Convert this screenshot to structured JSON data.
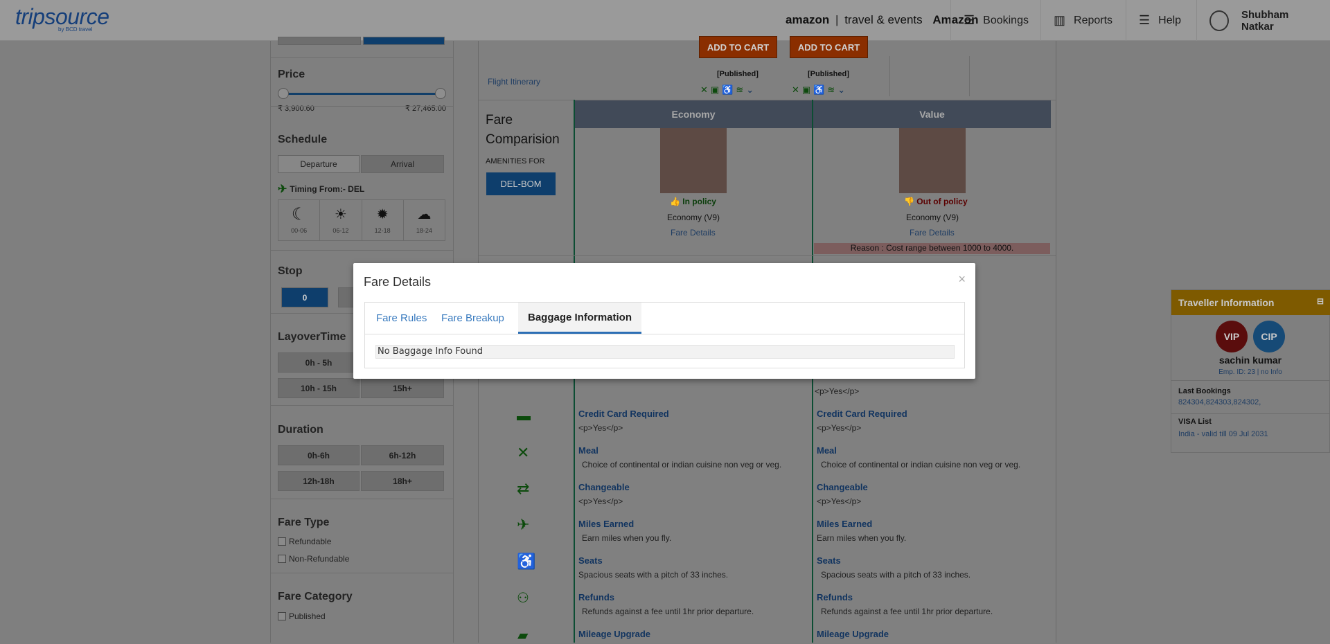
{
  "header": {
    "logo": "tripsource",
    "logo_sub": "by BCD travel",
    "client_brand": "amazon",
    "client_sub": "travel & events",
    "client_name": "Amazon",
    "nav": [
      {
        "label": "Bookings",
        "icon": "bookings-icon"
      },
      {
        "label": "Reports",
        "icon": "bar-chart-icon"
      },
      {
        "label": "Help",
        "icon": "menu-icon"
      }
    ],
    "user_name": "Shubham Natkar"
  },
  "filters": {
    "price": {
      "title": "Price",
      "min": "₹ 3,900.60",
      "max": "₹ 27,465.00"
    },
    "schedule": {
      "title": "Schedule",
      "tabs": [
        "Departure",
        "Arrival"
      ],
      "timing_label": "Timing From:- DEL",
      "slots": [
        {
          "label": "00-06",
          "icon": "moon-icon"
        },
        {
          "label": "06-12",
          "icon": "sunrise-icon"
        },
        {
          "label": "12-18",
          "icon": "sun-icon"
        },
        {
          "label": "18-24",
          "icon": "sunset-icon"
        }
      ]
    },
    "stop": {
      "title": "Stop",
      "options": [
        "0"
      ]
    },
    "layover": {
      "title": "LayoverTime",
      "options": [
        "0h - 5h",
        "10h - 15h",
        "15h+"
      ]
    },
    "duration": {
      "title": "Duration",
      "options": [
        "0h-6h",
        "6h-12h",
        "12h-18h",
        "18h+"
      ]
    },
    "fare_type": {
      "title": "Fare Type",
      "options": [
        "Refundable",
        "Non-Refundable"
      ]
    },
    "fare_category": {
      "title": "Fare Category",
      "options": [
        "Published"
      ]
    }
  },
  "results": {
    "flight_itinerary": "Flight Itinerary",
    "add_to_cart": "ADD TO CART",
    "published": "[Published]",
    "fare_comparison_title": "Fare Comparision",
    "amenities_for": "AMENITIES FOR",
    "route": "DEL-BOM",
    "columns": [
      {
        "name": "Economy",
        "policy": "In policy",
        "fare_class": "Economy (V9)",
        "fare_details": "Fare Details"
      },
      {
        "name": "Value",
        "policy": "Out of policy",
        "fare_class": "Economy (V9)",
        "fare_details": "Fare Details",
        "reason": "Reason : Cost range between 1000 to 4000."
      }
    ],
    "amenities": [
      {
        "title": "",
        "left": "",
        "right": "<p>Yes</p>"
      },
      {
        "title": "Credit Card Required",
        "left": "<p>Yes</p>",
        "right": "<p>Yes</p>"
      },
      {
        "title": "Meal",
        "left": "Choice of continental or indian cuisine non veg or veg.",
        "right": "Choice of continental or indian cuisine non veg or veg."
      },
      {
        "title": "Changeable",
        "left": "<p>Yes</p>",
        "right": "<p>Yes</p>"
      },
      {
        "title": "Miles Earned",
        "left": "Earn miles when you fly.",
        "right": "Earn miles when you fly."
      },
      {
        "title": "Seats",
        "left": "Spacious seats with a pitch of 33 inches.",
        "right": "Spacious seats with a pitch of 33 inches."
      },
      {
        "title": "Refunds",
        "left": "Refunds against a fee until 1hr prior departure.",
        "right": "Refunds against a fee until 1hr prior departure."
      },
      {
        "title": "Mileage Upgrade",
        "left": "",
        "right": ""
      }
    ]
  },
  "traveller": {
    "title": "Traveller Information",
    "badges": [
      "VIP",
      "CIP"
    ],
    "name": "sachin kumar",
    "emp": "Emp. ID: 23 | no Info",
    "last_bookings_label": "Last Bookings",
    "last_bookings": "824304,824303,824302,",
    "visa_label": "VISA List",
    "visa_country": "India",
    "visa_valid": " - valid till 09 Jul 2031"
  },
  "modal": {
    "title": "Fare Details",
    "close": "×",
    "tabs": [
      "Fare Rules",
      "Fare Breakup",
      "Baggage Information"
    ],
    "active_tab": "Baggage Information",
    "message": "No Baggage Info Found"
  },
  "colors": {
    "brand": "#163f7a",
    "link": "#3a7bbf",
    "accent_tab": "#2d6fb5",
    "cart": "#d25a00",
    "traveller_header": "#e3a200"
  }
}
